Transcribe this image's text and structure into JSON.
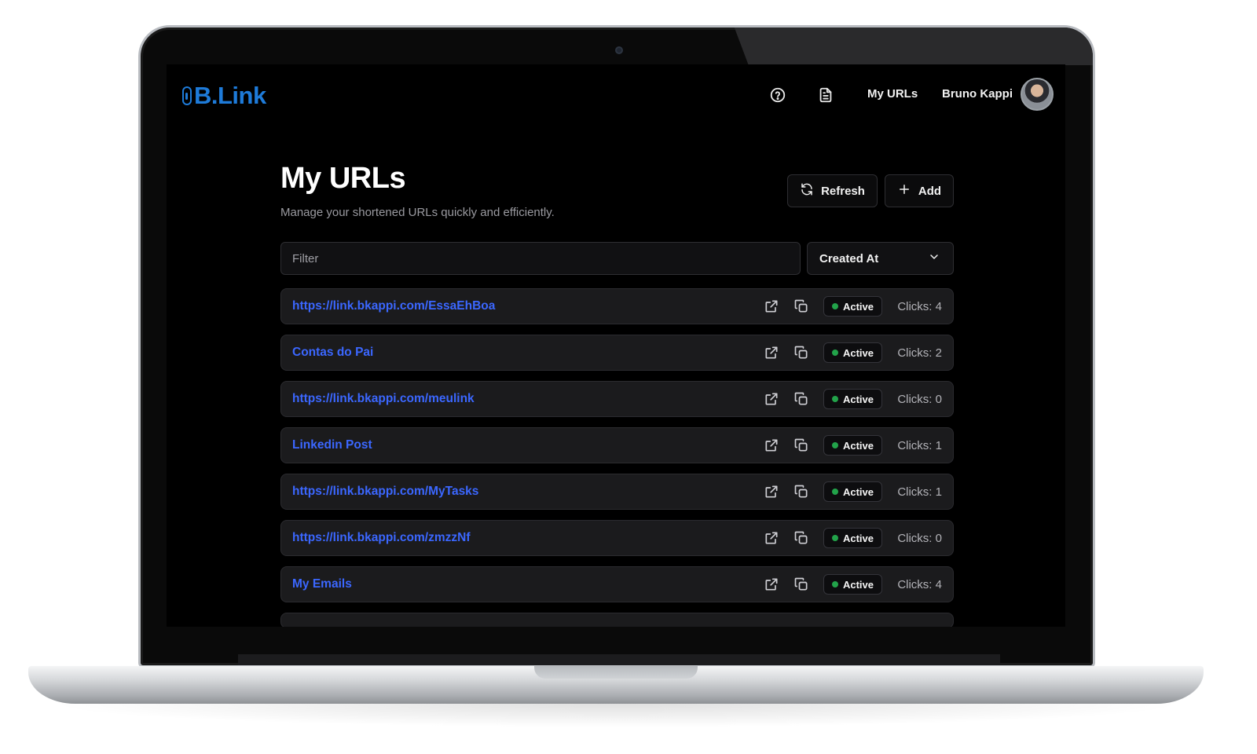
{
  "app": {
    "logo_text": "B.Link"
  },
  "header": {
    "nav_my_urls": "My URLs",
    "user_name": "Bruno Kappi"
  },
  "page": {
    "title": "My URLs",
    "subtitle": "Manage your shortened URLs quickly and efficiently.",
    "refresh_label": "Refresh",
    "add_label": "Add"
  },
  "filter": {
    "placeholder": "Filter",
    "value": ""
  },
  "sort": {
    "selected": "Created At"
  },
  "colors": {
    "accent": "#1e7bd9",
    "link": "#3b67ff",
    "status_active": "#22a34a"
  },
  "icons": [
    "help-circle-icon",
    "document-icon",
    "refresh-icon",
    "plus-icon",
    "chevron-down-icon",
    "external-link-icon",
    "copy-icon"
  ],
  "urls": [
    {
      "label": "https://link.bkappi.com/EssaEhBoa",
      "status": "Active",
      "clicks": "Clicks: 4"
    },
    {
      "label": "Contas do Pai",
      "status": "Active",
      "clicks": "Clicks: 2"
    },
    {
      "label": "https://link.bkappi.com/meulink",
      "status": "Active",
      "clicks": "Clicks: 0"
    },
    {
      "label": "Linkedin Post",
      "status": "Active",
      "clicks": "Clicks: 1"
    },
    {
      "label": "https://link.bkappi.com/MyTasks",
      "status": "Active",
      "clicks": "Clicks: 1"
    },
    {
      "label": "https://link.bkappi.com/zmzzNf",
      "status": "Active",
      "clicks": "Clicks: 0"
    },
    {
      "label": "My Emails",
      "status": "Active",
      "clicks": "Clicks: 4"
    }
  ]
}
